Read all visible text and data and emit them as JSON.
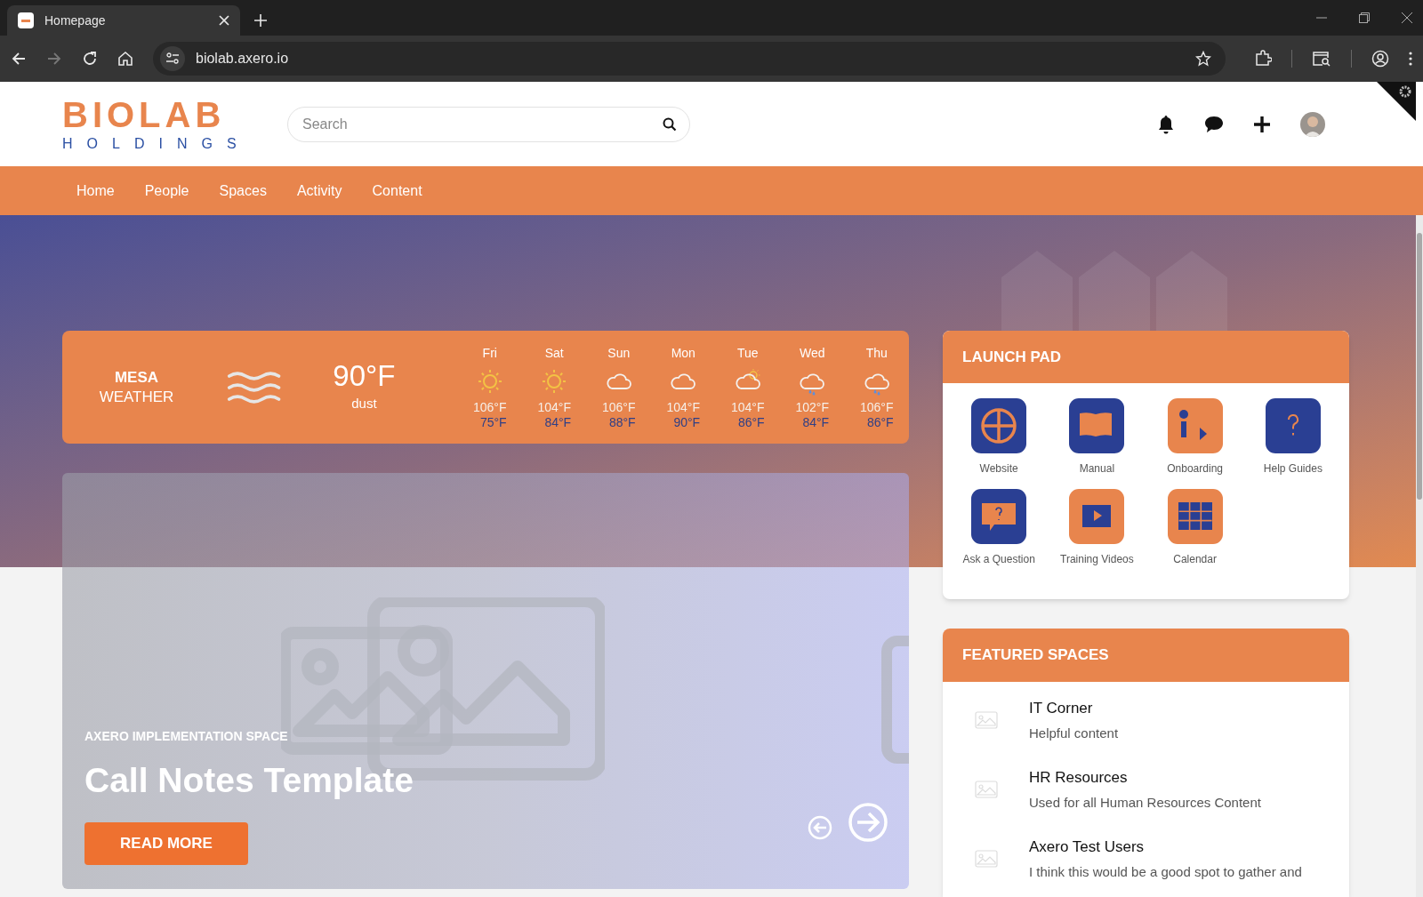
{
  "browser": {
    "tab_title": "Homepage",
    "url": "biolab.axero.io"
  },
  "logo": {
    "line_1": "BIOLAB",
    "line_2": "HOLDINGS"
  },
  "search": {
    "placeholder": "Search"
  },
  "nav": [
    "Home",
    "People",
    "Spaces",
    "Activity",
    "Content"
  ],
  "weather": {
    "city": "MESA",
    "label": "WEATHER",
    "temperature": "90°F",
    "condition": "dust",
    "days": [
      {
        "day": "Fri",
        "kind": "sunny",
        "high": "106°F",
        "low": "75°F"
      },
      {
        "day": "Sat",
        "kind": "sunny",
        "high": "104°F",
        "low": "84°F"
      },
      {
        "day": "Sun",
        "kind": "cloudy",
        "high": "106°F",
        "low": "88°F"
      },
      {
        "day": "Mon",
        "kind": "cloudy",
        "high": "104°F",
        "low": "90°F"
      },
      {
        "day": "Tue",
        "kind": "partly-cloudy",
        "high": "104°F",
        "low": "86°F"
      },
      {
        "day": "Wed",
        "kind": "rain",
        "high": "102°F",
        "low": "84°F"
      },
      {
        "day": "Thu",
        "kind": "rain",
        "high": "106°F",
        "low": "86°F"
      }
    ]
  },
  "slide": {
    "eyebrow": "AXERO IMPLEMENTATION SPACE",
    "title": "Call Notes Template",
    "button": "READ MORE"
  },
  "launch_pad": {
    "title": "LAUNCH PAD",
    "items": [
      {
        "label": "Website",
        "color": "#2a3f93"
      },
      {
        "label": "Manual",
        "color": "#2a3f93"
      },
      {
        "label": "Onboarding",
        "color": "#e8854d"
      },
      {
        "label": "Help Guides",
        "color": "#2a3f93"
      },
      {
        "label": "Ask a Question",
        "color": "#2a3f93"
      },
      {
        "label": "Training Videos",
        "color": "#e8854d"
      },
      {
        "label": "Calendar",
        "color": "#e8854d"
      }
    ]
  },
  "featured_spaces": {
    "title": "FEATURED SPACES",
    "items": [
      {
        "name": "IT Corner",
        "description": "Helpful content"
      },
      {
        "name": "HR Resources",
        "description": "Used for all Human Resources Content"
      },
      {
        "name": "Axero Test Users",
        "description": "I think this would be a good spot to gather and"
      }
    ]
  }
}
